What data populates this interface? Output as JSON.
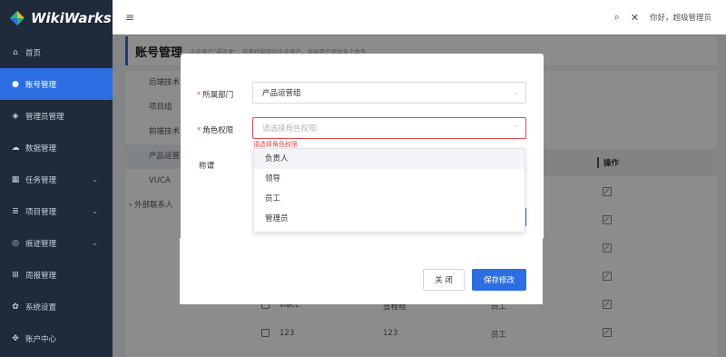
{
  "app": {
    "logo_text": "WikiWarks"
  },
  "sidebar": {
    "items": [
      {
        "label": "首页",
        "icon": "home-icon",
        "glyph": "⌂",
        "active": false
      },
      {
        "label": "账号管理",
        "icon": "user-icon",
        "glyph": "●",
        "active": true
      },
      {
        "label": "管理员管理",
        "icon": "shield-icon",
        "glyph": "◈",
        "active": false
      },
      {
        "label": "数据管理",
        "icon": "cloud-icon",
        "glyph": "☁",
        "active": false
      },
      {
        "label": "任务管理",
        "icon": "grid-icon",
        "glyph": "▦",
        "active": false,
        "chevron": "⌄"
      },
      {
        "label": "项目管理",
        "icon": "list-icon",
        "glyph": "≣",
        "active": false,
        "chevron": "⌄"
      },
      {
        "label": "痕迹管理",
        "icon": "trace-icon",
        "glyph": "◎",
        "active": false,
        "chevron": "⌄"
      },
      {
        "label": "周报管理",
        "icon": "calendar-icon",
        "glyph": "⊞",
        "active": false
      },
      {
        "label": "系统设置",
        "icon": "gear-icon",
        "glyph": "✿",
        "active": false
      },
      {
        "label": "账户中心",
        "icon": "account-icon",
        "glyph": "✥",
        "active": false
      }
    ]
  },
  "topbar": {
    "greeting": "你好，超级管理员"
  },
  "page": {
    "title": "账号管理",
    "desc": "企业用户\"通讯录\"，可查找和添加企业用户，并给用户添加多个角色"
  },
  "tree": {
    "items": [
      "后端技术",
      "项目组",
      "前端技术",
      "产品运营",
      "VUCA"
    ],
    "external": "外部联系人"
  },
  "table": {
    "op_header": "操作",
    "rows": [
      {
        "name": "xiacc",
        "dept": "查程程",
        "role": "员工"
      },
      {
        "name": "123",
        "dept": "123",
        "role": "员工"
      }
    ]
  },
  "modal": {
    "dept_label": "所属部门",
    "dept_value": "产品运营组",
    "role_label": "角色权限",
    "role_placeholder": "请选择角色权限",
    "role_error": "请选择角色权限",
    "title_label": "称谓",
    "options": [
      "负责人",
      "领导",
      "员工",
      "管理员"
    ],
    "close_label": "关 闭",
    "save_label": "保存修改"
  },
  "colors": {
    "primary": "#2d6fe3",
    "sidebar": "#1f2a3a",
    "error": "#e5484d"
  }
}
